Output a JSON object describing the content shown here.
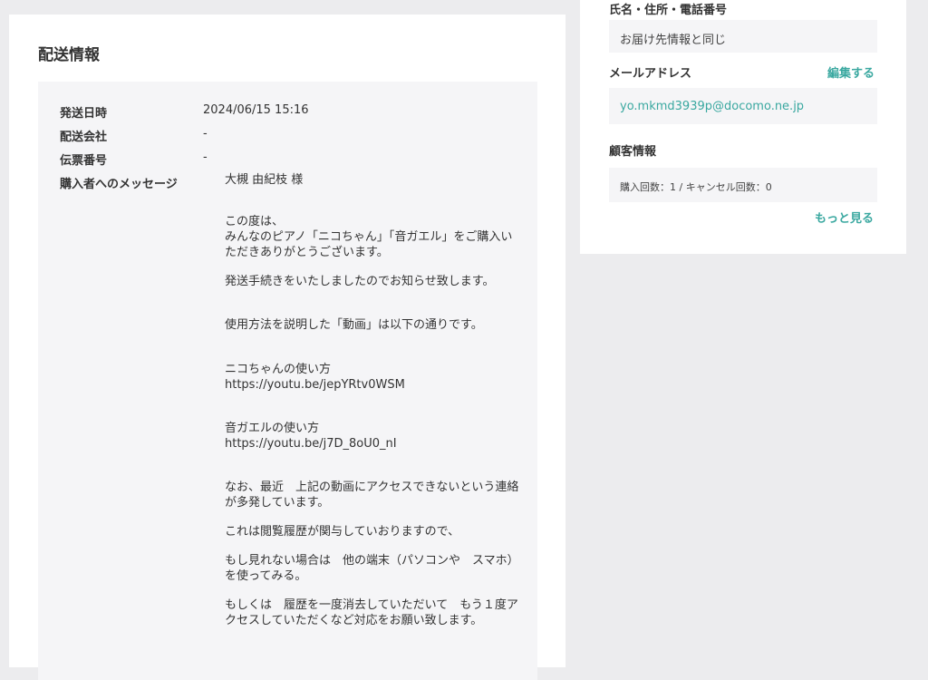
{
  "shipping": {
    "title": "配送情報",
    "rows": [
      {
        "label": "発送日時",
        "value": "2024/06/15 15:16"
      },
      {
        "label": "配送会社",
        "value": "-"
      },
      {
        "label": "伝票番号",
        "value": "-"
      }
    ],
    "message_label": "購入者へのメッセージ",
    "message_paragraphs": [
      "大槻 由紀枝 様",
      "この度は、\nみんなのピアノ「ニコちゃん」「音ガエル」をご購入いただきありがとうございます。",
      "発送手続きをいたしましたのでお知らせ致します。",
      "使用方法を説明した「動画」は以下の通りです。",
      "ニコちゃんの使い方\nhttps://youtu.be/jepYRtv0WSM",
      "音ガエルの使い方\nhttps://youtu.be/j7D_8oU0_nI",
      "なお、最近　上記の動画にアクセスできないという連絡が多発しています。",
      "これは閲覧履歴が関与していおりますので、",
      "もし見れない場合は　他の端末（パソコンや　スマホ）を使ってみる。",
      "もしくは　履歴を一度消去していただいて　もう１度アクセスしていただくなど対応をお願い致します。"
    ]
  },
  "customer": {
    "name_address_label": "氏名・住所・電話番号",
    "name_address_value": "お届け先情報と同じ",
    "email_label": "メールアドレス",
    "email_edit": "編集する",
    "email_value": "yo.mkmd3939p@docomo.ne.jp",
    "info_label": "顧客情報",
    "info_value": "購入回数：1 / キャンセル回数：0",
    "more_link": "もっと見る"
  }
}
